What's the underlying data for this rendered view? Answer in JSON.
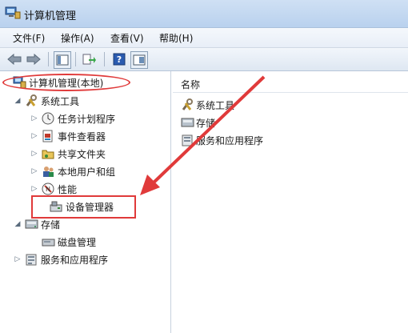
{
  "window": {
    "title": "计算机管理"
  },
  "menu": [
    "文件(F)",
    "操作(A)",
    "查看(V)",
    "帮助(H)"
  ],
  "toolbar": {
    "buttons": [
      "back-icon",
      "forward-icon",
      "show-hide-tree-icon",
      "export-list-icon",
      "help-icon",
      "properties-icon"
    ]
  },
  "tree": {
    "root": "计算机管理(本地)",
    "system_tools": "系统工具",
    "task_scheduler": "任务计划程序",
    "event_viewer": "事件查看器",
    "shared_folders": "共享文件夹",
    "local_users": "本地用户和组",
    "performance": "性能",
    "device_manager": "设备管理器",
    "storage": "存储",
    "disk_management": "磁盘管理",
    "services_apps": "服务和应用程序"
  },
  "list": {
    "column_name": "名称",
    "items": [
      "系统工具",
      "存储",
      "服务和应用程序"
    ]
  },
  "colors": {
    "highlight": "#e03a3a"
  }
}
